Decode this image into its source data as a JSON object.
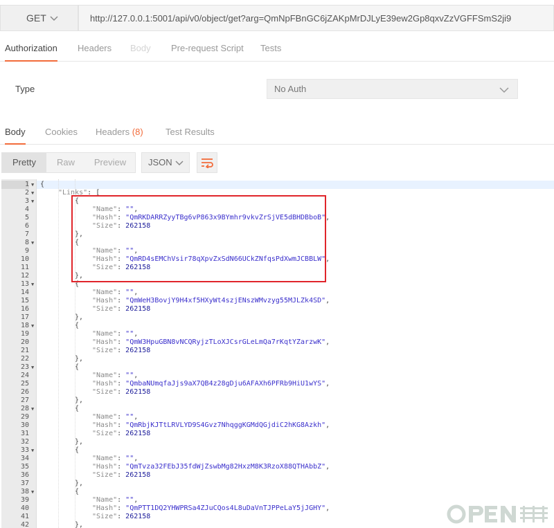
{
  "request": {
    "method": "GET",
    "url": "http://127.0.0.1:5001/api/v0/object/get?arg=QmNpFBnGC6jZAKpMrDJLyE39ew2Gp8qxvZzVGFFSmS2ji9"
  },
  "request_tabs": [
    {
      "label": "Authorization",
      "state": "active"
    },
    {
      "label": "Headers",
      "state": "normal"
    },
    {
      "label": "Body",
      "state": "disabled"
    },
    {
      "label": "Pre-request Script",
      "state": "normal"
    },
    {
      "label": "Tests",
      "state": "normal"
    }
  ],
  "auth": {
    "type_label": "Type",
    "selected": "No Auth"
  },
  "response_tabs": {
    "body": "Body",
    "cookies": "Cookies",
    "headers": "Headers",
    "headers_count": "(8)",
    "tests": "Test Results"
  },
  "response_toolbar": {
    "views": [
      "Pretty",
      "Raw",
      "Preview"
    ],
    "format": "JSON"
  },
  "code": {
    "open": "{",
    "links_key": "\"Links\"",
    "links_open": ": [",
    "obj_open": "{",
    "obj_close": "},",
    "name_key": "\"Name\"",
    "name_val": "\"\"",
    "hash_key": "\"Hash\"",
    "size_key": "\"Size\"",
    "entries": [
      {
        "hash": "\"QmRKDARRZyyTBg6vP863x9BYmhr9vkvZrSjVE5dBHDBboB\"",
        "size": "262158"
      },
      {
        "hash": "\"QmRD4sEMChVsir78qXpvZxSdN66UCkZNfqsPdXwmJCBBLW\"",
        "size": "262158"
      },
      {
        "hash": "\"QmWeH3BovjY9H4xf5HXyWt4szjENszWMvzyg55MJLZk4SD\"",
        "size": "262158"
      },
      {
        "hash": "\"QmW3HpuGBN8vNCQRyjzTLoXJCsrGLeLmQa7rKqtYZarzwK\"",
        "size": "262158"
      },
      {
        "hash": "\"QmbaNUmqfaJjs9aX7QB4z28gDju6AFAXh6PFRb9HiU1wYS\"",
        "size": "262158"
      },
      {
        "hash": "\"QmRbjKJTtLRVLYD9S4Gvz7NhqggKGMdQGjdiC2hKG8Azkh\"",
        "size": "262158"
      },
      {
        "hash": "\"QmTvza32FEbJ35fdWjZswbMg82HxzM8K3RzoX88QTHAbbZ\"",
        "size": "262158"
      },
      {
        "hash": "\"QmPTT1DQ2YHWPRSa4ZJuCQos4L8uDaVnTJPPeLaY5jJGHY\"",
        "size": "262158"
      }
    ]
  },
  "line_numbers": [
    "1",
    "2",
    "3",
    "4",
    "5",
    "6",
    "7",
    "8",
    "9",
    "10",
    "11",
    "12",
    "13",
    "14",
    "15",
    "16",
    "17",
    "18",
    "19",
    "20",
    "21",
    "22",
    "23",
    "24",
    "25",
    "26",
    "27",
    "28",
    "29",
    "30",
    "31",
    "32",
    "33",
    "34",
    "35",
    "36",
    "37",
    "38",
    "39",
    "40",
    "41",
    "42"
  ],
  "fold_lines": [
    "1",
    "2",
    "3",
    "8",
    "13",
    "18",
    "23",
    "28",
    "33",
    "38"
  ],
  "colors": {
    "accent": "#f26b3a",
    "highlight_box": "#e0242a",
    "string": "#3a2fcc"
  }
}
